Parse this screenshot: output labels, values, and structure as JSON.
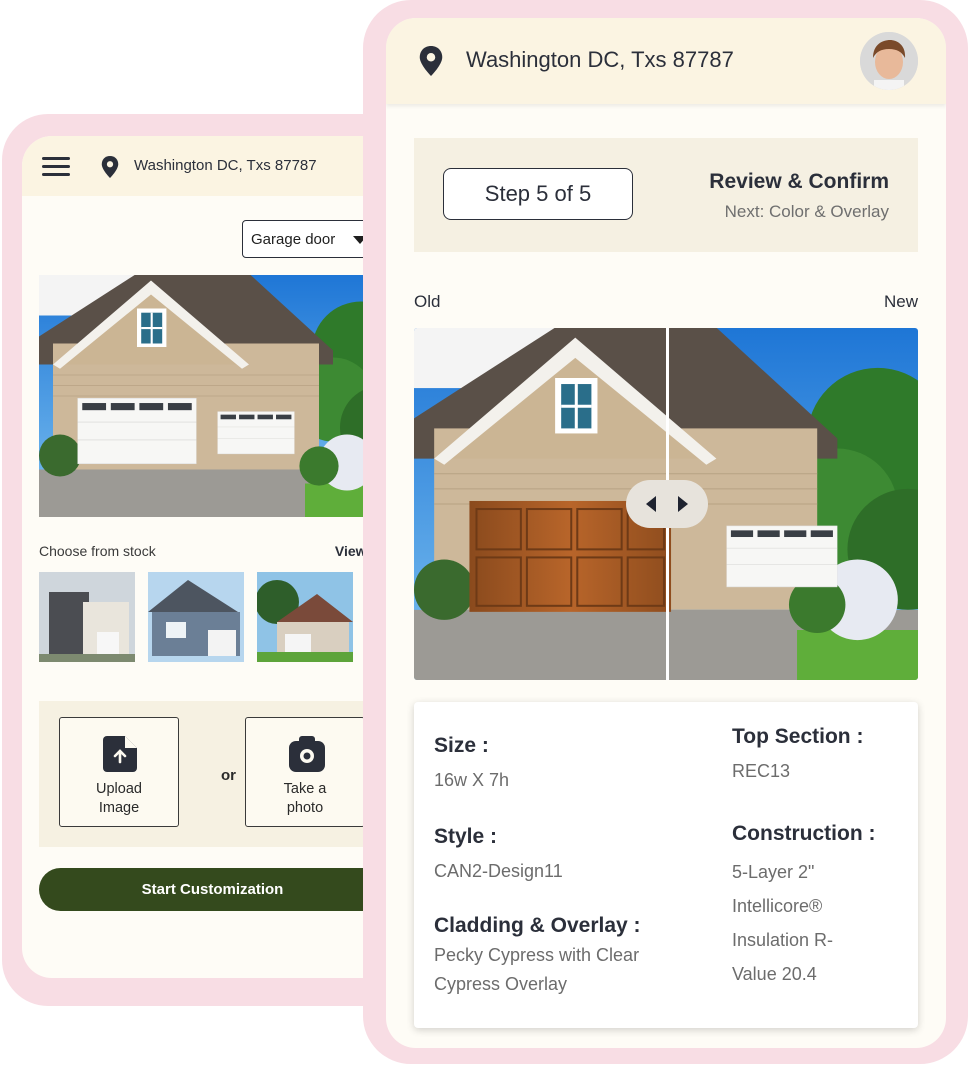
{
  "left_screen": {
    "location": "Washington DC, Txs 87787",
    "category_select": "Garage door",
    "stock_label": "Choose from stock",
    "view_all": "View all",
    "upload_label": "Upload\nImage",
    "or_text": "or",
    "photo_label": "Take a\nphoto",
    "start_button": "Start Customization"
  },
  "right_screen": {
    "location": "Washington DC, Txs 87787",
    "step_indicator": "Step 5 of 5",
    "step_title": "Review & Confirm",
    "step_next": "Next: Color & Overlay",
    "old_label": "Old",
    "new_label": "New",
    "details": {
      "size_label": "Size :",
      "size_value": "16w X 7h",
      "style_label": "Style :",
      "style_value": "CAN2-Design11",
      "cladding_label": "Cladding & Overlay :",
      "cladding_value": "Pecky Cypress with Clear Cypress Overlay",
      "top_label": "Top Section :",
      "top_value": "REC13",
      "construction_label": "Construction :",
      "construction_value": "5-Layer 2\" Intellicore® Insulation R-Value 20.4"
    }
  },
  "colors": {
    "accent_dark": "#2b2f3a",
    "button_green": "#344a1d",
    "frame_pink": "#f8dde4",
    "header_cream": "#fbf4e2"
  }
}
